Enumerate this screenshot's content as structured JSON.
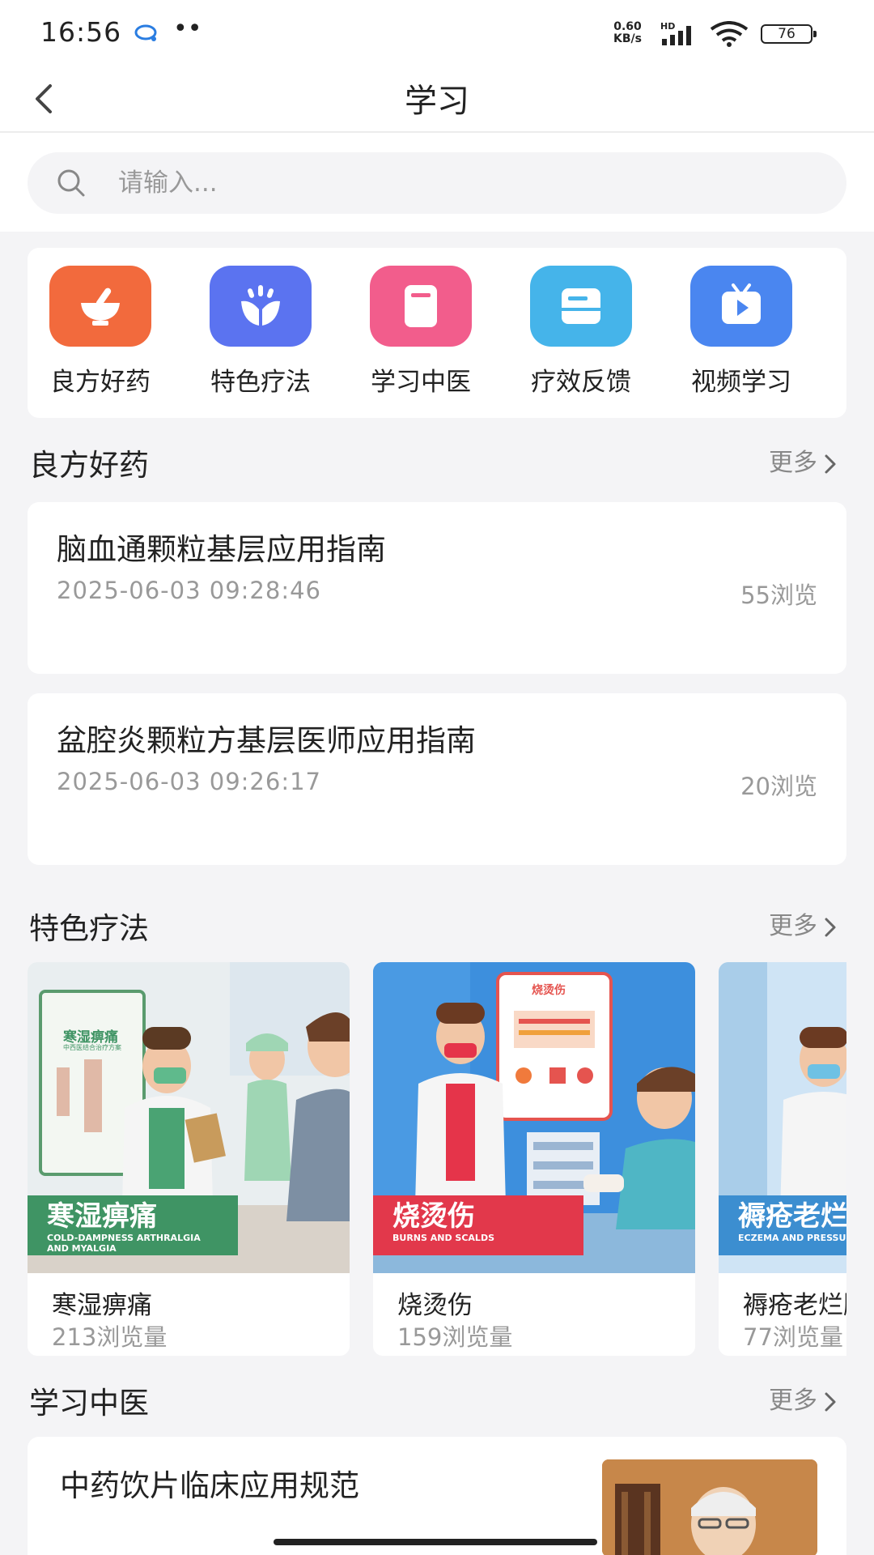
{
  "status": {
    "time": "16:56",
    "net_speed_value": "0.60",
    "net_speed_unit": "KB/s",
    "network_badge": "HD",
    "battery": "76"
  },
  "header": {
    "title": "学习"
  },
  "search": {
    "placeholder": "请输入..."
  },
  "quick_links": [
    {
      "label": "良方好药",
      "icon": "mortar-bowl-icon",
      "color": "#f26a3d"
    },
    {
      "label": "特色疗法",
      "icon": "wheat-icon",
      "color": "#5b73f0"
    },
    {
      "label": "学习中医",
      "icon": "book-icon",
      "color": "#f25d8c"
    },
    {
      "label": "疗效反馈",
      "icon": "feedback-box-icon",
      "color": "#45b4ea"
    },
    {
      "label": "视频学习",
      "icon": "tv-icon",
      "color": "#4a86f0"
    }
  ],
  "sections": {
    "prescriptions": {
      "title": "良方好药",
      "more": "更多",
      "articles": [
        {
          "title": "脑血通颗粒基层应用指南",
          "date": "2025-06-03 09:28:46",
          "views": "55浏览"
        },
        {
          "title": "盆腔炎颗粒方基层医师应用指南",
          "date": "2025-06-03 09:26:17",
          "views": "20浏览"
        }
      ]
    },
    "therapies": {
      "title": "特色疗法",
      "more": "更多",
      "cards": [
        {
          "name": "寒湿痹痛",
          "views": "213浏览量",
          "banner_title": "寒湿痹痛",
          "banner_subtitle_1": "COLD-DAMPNESS ARTHRALGIA",
          "banner_subtitle_2": "AND MYALGIA",
          "poster_title": "寒湿痹痛",
          "poster_subtitle": "中西医结合治疗方案"
        },
        {
          "name": "烧烫伤",
          "views": "159浏览量",
          "banner_title": "烧烫伤",
          "banner_subtitle_1": "BURNS AND SCALDS",
          "banner_subtitle_2": "",
          "poster_title": "烧烫伤"
        },
        {
          "name": "褥疮老烂腿",
          "views": "77浏览量",
          "banner_title": "褥疮老烂腿",
          "banner_subtitle_1": "ECZEMA AND PRESSURE",
          "banner_subtitle_2": ""
        }
      ]
    },
    "tcm": {
      "title": "学习中医",
      "more": "更多",
      "articles": [
        {
          "title": "中药饮片临床应用规范"
        }
      ]
    }
  }
}
